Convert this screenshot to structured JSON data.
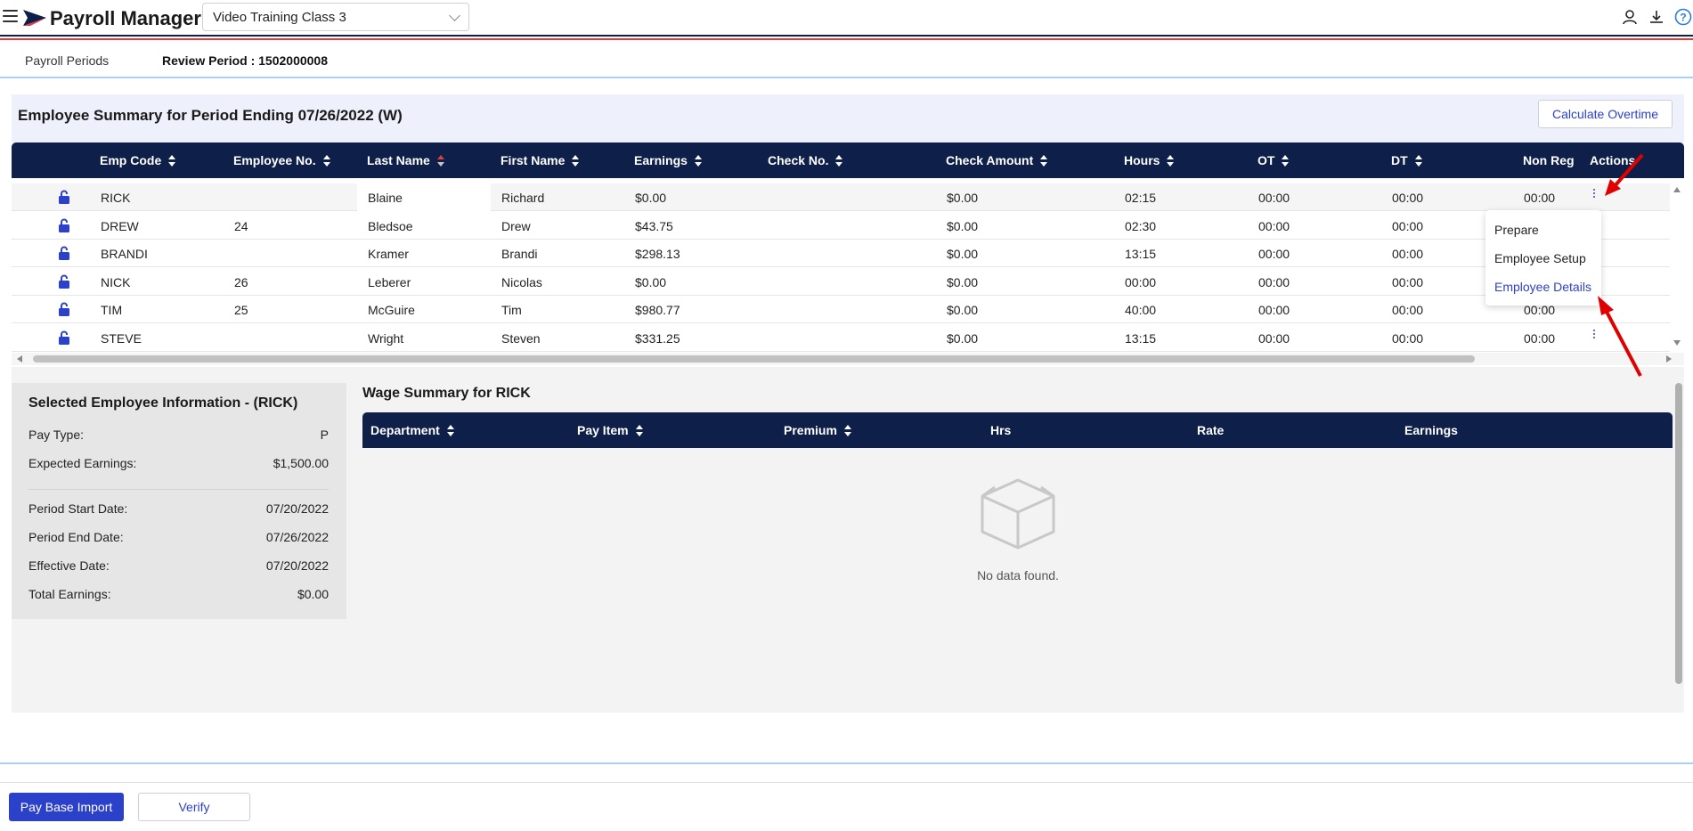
{
  "app": {
    "title": "Payroll Manager",
    "company_select": "Video Training Class 3",
    "icons": [
      "user-icon",
      "download-icon",
      "help-icon"
    ],
    "colors": {
      "navy": "#0e1f4a",
      "accent_blue": "#2c41c9",
      "red": "#e23b3b",
      "light_blue": "#a9d1f5"
    }
  },
  "tabs": [
    {
      "label": "Payroll Periods",
      "active": false
    },
    {
      "label": "Review Period : 1502000008",
      "active": true
    }
  ],
  "summary": {
    "title": "Employee Summary for Period Ending 07/26/2022 (W)",
    "calc_button": "Calculate Overtime"
  },
  "employee_table": {
    "columns": [
      "Emp Code",
      "Employee No.",
      "Last Name",
      "First Name",
      "Earnings",
      "Check No.",
      "Check Amount",
      "Hours",
      "OT",
      "DT",
      "Non Reg",
      "Actions"
    ],
    "sorted_column": "Last Name",
    "rows": [
      {
        "emp_code": "RICK",
        "emp_no": "",
        "last": "Blaine",
        "first": "Richard",
        "earnings": "$0.00",
        "check_no": "",
        "check_amt": "$0.00",
        "hours": "02:15",
        "ot": "00:00",
        "dt": "00:00",
        "nonreg": "00:00"
      },
      {
        "emp_code": "DREW",
        "emp_no": "24",
        "last": "Bledsoe",
        "first": "Drew",
        "earnings": "$43.75",
        "check_no": "",
        "check_amt": "$0.00",
        "hours": "02:30",
        "ot": "00:00",
        "dt": "00:00",
        "nonreg": ""
      },
      {
        "emp_code": "BRANDI",
        "emp_no": "",
        "last": "Kramer",
        "first": "Brandi",
        "earnings": "$298.13",
        "check_no": "",
        "check_amt": "$0.00",
        "hours": "13:15",
        "ot": "00:00",
        "dt": "00:00",
        "nonreg": ""
      },
      {
        "emp_code": "NICK",
        "emp_no": "26",
        "last": "Leberer",
        "first": "Nicolas",
        "earnings": "$0.00",
        "check_no": "",
        "check_amt": "$0.00",
        "hours": "00:00",
        "ot": "00:00",
        "dt": "00:00",
        "nonreg": ""
      },
      {
        "emp_code": "TIM",
        "emp_no": "25",
        "last": "McGuire",
        "first": "Tim",
        "earnings": "$980.77",
        "check_no": "",
        "check_amt": "$0.00",
        "hours": "40:00",
        "ot": "00:00",
        "dt": "00:00",
        "nonreg": "00:00"
      },
      {
        "emp_code": "STEVE",
        "emp_no": "",
        "last": "Wright",
        "first": "Steven",
        "earnings": "$331.25",
        "check_no": "",
        "check_amt": "$0.00",
        "hours": "13:15",
        "ot": "00:00",
        "dt": "00:00",
        "nonreg": "00:00"
      }
    ]
  },
  "action_menu": {
    "items": [
      "Prepare",
      "Employee Setup",
      "Employee Details"
    ],
    "highlighted": "Employee Details"
  },
  "selected_employee": {
    "title": "Selected Employee Information - (RICK)",
    "pay_type_label": "Pay Type:",
    "pay_type": "P",
    "expected_earnings_label": "Expected Earnings:",
    "expected_earnings": "$1,500.00",
    "period_start_label": "Period Start Date:",
    "period_start": "07/20/2022",
    "period_end_label": "Period End Date:",
    "period_end": "07/26/2022",
    "effective_label": "Effective Date:",
    "effective": "07/20/2022",
    "total_earnings_label": "Total Earnings:",
    "total_earnings": "$0.00"
  },
  "wage_summary": {
    "title": "Wage Summary for RICK",
    "columns": [
      "Department",
      "Pay Item",
      "Premium",
      "Hrs",
      "Rate",
      "Earnings"
    ],
    "empty_text": "No data found."
  },
  "footer": {
    "primary_button": "Pay Base Import",
    "secondary_button": "Verify"
  }
}
